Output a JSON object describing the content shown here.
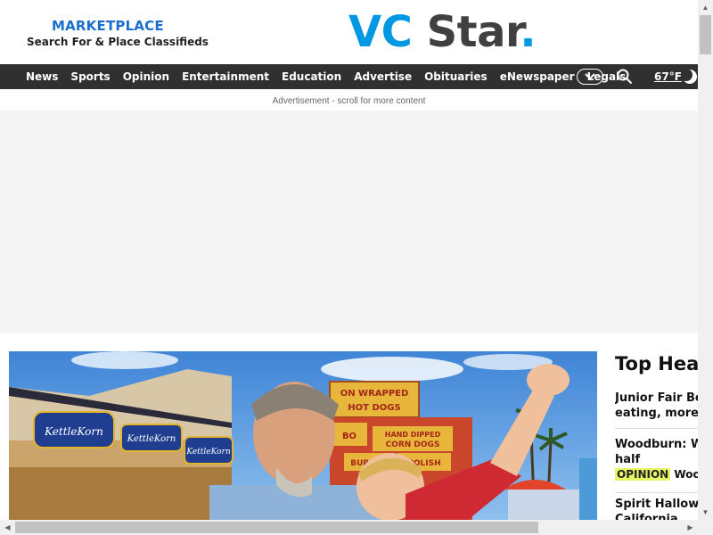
{
  "marketplace": {
    "title": "MARKETPLACE",
    "subtitle": "Search For & Place Classifieds"
  },
  "logo": {
    "part1": "VC",
    "part2": " Star",
    "dot": "."
  },
  "nav": {
    "items": [
      "News",
      "Sports",
      "Opinion",
      "Entertainment",
      "Education",
      "Advertise",
      "Obituaries",
      "eNewspaper",
      "Legals"
    ],
    "more_icon": "chevron-down-icon",
    "search_icon": "search-icon",
    "temperature": "67°F",
    "weather_icon": "moon-icon"
  },
  "ad": {
    "label": "Advertisement - scroll for more content"
  },
  "top_headlines": {
    "title": "Top Hea",
    "items": [
      {
        "line1": "Junior Fair Bo",
        "line2": "eating, more"
      },
      {
        "line1": "Woodburn: Wi",
        "line2": "half",
        "tag": "OPINION",
        "tag_rest": " Woody"
      },
      {
        "line1": "Spirit Hallowe",
        "line2": "California"
      }
    ]
  },
  "hero": {
    "signs": [
      "KettleKorn",
      "KettleKorn",
      "KettleKorn",
      "ON WRAPPED",
      "HOT DOGS",
      "BO",
      "HAND DIPPED",
      "CORN DOGS",
      "BURGER",
      "POLISH"
    ]
  },
  "colors": {
    "brand_blue": "#0098e3",
    "nav_bg": "#303030",
    "opinion_tag": "#e6f564"
  }
}
